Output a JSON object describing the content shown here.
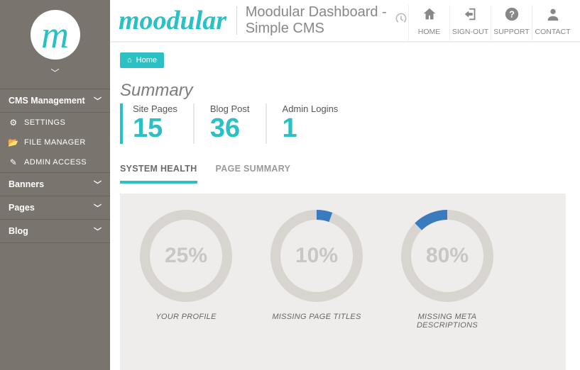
{
  "colors": {
    "accent": "#2bc1c4",
    "blue": "#3a7bbf"
  },
  "sidebar": {
    "groups": [
      {
        "label": "CMS Management",
        "items": [
          {
            "icon": "gear-icon",
            "glyph": "⚙",
            "label": "SETTINGS"
          },
          {
            "icon": "folder-open-icon",
            "glyph": "📂",
            "label": "FILE MANAGER"
          },
          {
            "icon": "pencil-icon",
            "glyph": "✎",
            "label": "ADMIN ACCESS"
          }
        ]
      },
      {
        "label": "Banners",
        "items": []
      },
      {
        "label": "Pages",
        "items": []
      },
      {
        "label": "Blog",
        "items": []
      }
    ]
  },
  "header": {
    "brand": "moodular",
    "title": "Moodular Dashboard - Simple CMS",
    "actions": [
      {
        "name": "home",
        "label": "HOME",
        "glyph": "⌂"
      },
      {
        "name": "sign-out",
        "label": "SIGN-OUT",
        "glyph": "⎋"
      },
      {
        "name": "support",
        "label": "SUPPORT",
        "glyph": "?"
      },
      {
        "name": "contact",
        "label": "CONTACT",
        "glyph": "👤"
      }
    ]
  },
  "breadcrumb": {
    "icon_glyph": "⌂",
    "label": "Home"
  },
  "summary": {
    "heading": "Summary",
    "stats": [
      {
        "label": "Site Pages",
        "value": "15"
      },
      {
        "label": "Blog Post",
        "value": "36"
      },
      {
        "label": "Admin Logins",
        "value": "1"
      }
    ]
  },
  "tabs": [
    {
      "name": "system-health",
      "label": "SYSTEM HEALTH",
      "active": true
    },
    {
      "name": "page-summary",
      "label": "PAGE SUMMARY",
      "active": false
    }
  ],
  "chart_data": [
    {
      "type": "pie",
      "title": "YOUR PROFILE",
      "value": 25,
      "display": "25%",
      "start_deg": 270,
      "color": "#3a7bbf",
      "track": "#d8d5d1"
    },
    {
      "type": "pie",
      "title": "MISSING PAGE TITLES",
      "value": 10,
      "display": "10%",
      "start_deg": 290,
      "color": "#3a7bbf",
      "track": "#d8d5d1"
    },
    {
      "type": "pie",
      "title": "MISSING META DESCRIPTIONS",
      "value": 80,
      "display": "80%",
      "start_deg": 225,
      "color": "#3a7bbf",
      "track": "#d8d5d1"
    }
  ]
}
